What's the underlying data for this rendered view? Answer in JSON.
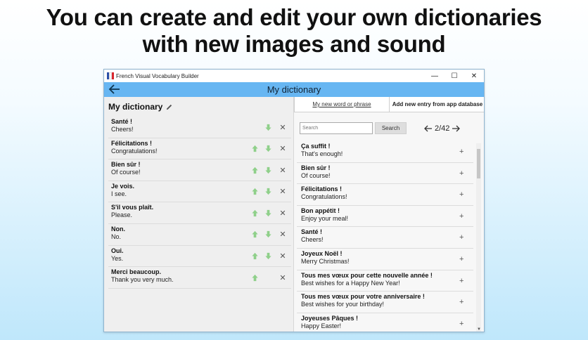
{
  "headline": {
    "line1": "You can create and edit your own dictionaries",
    "line2": "with new images and sound"
  },
  "window": {
    "title": "French Visual Vocabulary Builder",
    "controls": [
      "—",
      "☐",
      "✕"
    ]
  },
  "appbar": {
    "title": "My dictionary"
  },
  "left": {
    "title": "My dictionary",
    "entries": [
      {
        "fr": "Santé !",
        "en": "Cheers!",
        "up": false
      },
      {
        "fr": "Félicitations !",
        "en": "Congratulations!",
        "up": true
      },
      {
        "fr": "Bien sûr !",
        "en": "Of course!",
        "up": true
      },
      {
        "fr": "Je vois.",
        "en": "I see.",
        "up": true
      },
      {
        "fr": "S'il vous plaît.",
        "en": "Please.",
        "up": true
      },
      {
        "fr": "Non.",
        "en": "No.",
        "up": true
      },
      {
        "fr": "Oui.",
        "en": "Yes.",
        "up": true
      },
      {
        "fr": "Merci beaucoup.",
        "en": "Thank you very much.",
        "up": true,
        "down": false
      }
    ],
    "delete_glyph": "✕"
  },
  "right": {
    "tab_new": "My new word or phrase",
    "tab_db": "Add new entry from app database",
    "search_placeholder": "Search",
    "search_button": "Search",
    "page": "2/42",
    "entries": [
      {
        "fr": "Ça suffit !",
        "en": "That's enough!"
      },
      {
        "fr": "Bien sûr !",
        "en": "Of course!"
      },
      {
        "fr": "Félicitations !",
        "en": "Congratulations!"
      },
      {
        "fr": "Bon appétit !",
        "en": "Enjoy your meal!"
      },
      {
        "fr": "Santé !",
        "en": "Cheers!"
      },
      {
        "fr": "Joyeux Noël !",
        "en": "Merry Christmas!"
      },
      {
        "fr": "Tous mes vœux pour cette nouvelle année !",
        "en": "Best wishes for a Happy New Year!"
      },
      {
        "fr": "Tous mes vœux pour votre anniversaire !",
        "en": "Best wishes for your birthday!"
      },
      {
        "fr": "Joyeuses Pâques !",
        "en": "Happy Easter!"
      }
    ],
    "add_glyph": "+"
  },
  "colors": {
    "appbar": "#67b6f2",
    "move_arrow": "#8fd08a",
    "background_bottom": "#bfe7fb"
  },
  "icons": {
    "back": "arrow-left-icon",
    "edit": "pencil-icon",
    "move_up": "arrow-up-icon",
    "move_down": "arrow-down-icon",
    "delete": "close-icon",
    "prev_page": "arrow-left-icon",
    "next_page": "arrow-right-icon",
    "add": "plus-icon"
  }
}
